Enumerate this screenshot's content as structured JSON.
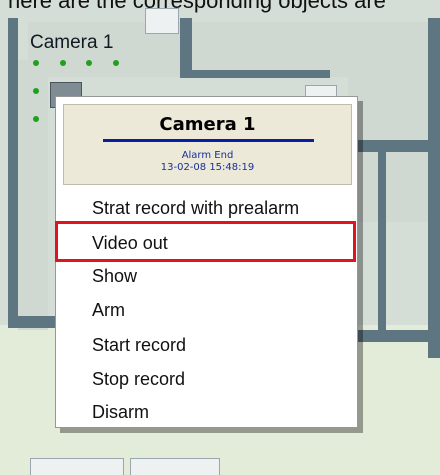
{
  "window": {
    "top_text": "here are the corresponding objects are"
  },
  "map": {
    "camera_label": "Camera 1"
  },
  "popup": {
    "title": "Camera 1",
    "status": "Alarm End",
    "timestamp": "13-02-08 15:48:19",
    "items": [
      "Strat record with prealarm",
      "Video out",
      "Show",
      "Arm",
      "Start record",
      "Stop record",
      "Disarm"
    ],
    "highlighted_item": "Video out"
  },
  "colors": {
    "highlight": "#e0141c",
    "header_bg": "#ece9d8",
    "title_rule": "#0a1f9f"
  }
}
